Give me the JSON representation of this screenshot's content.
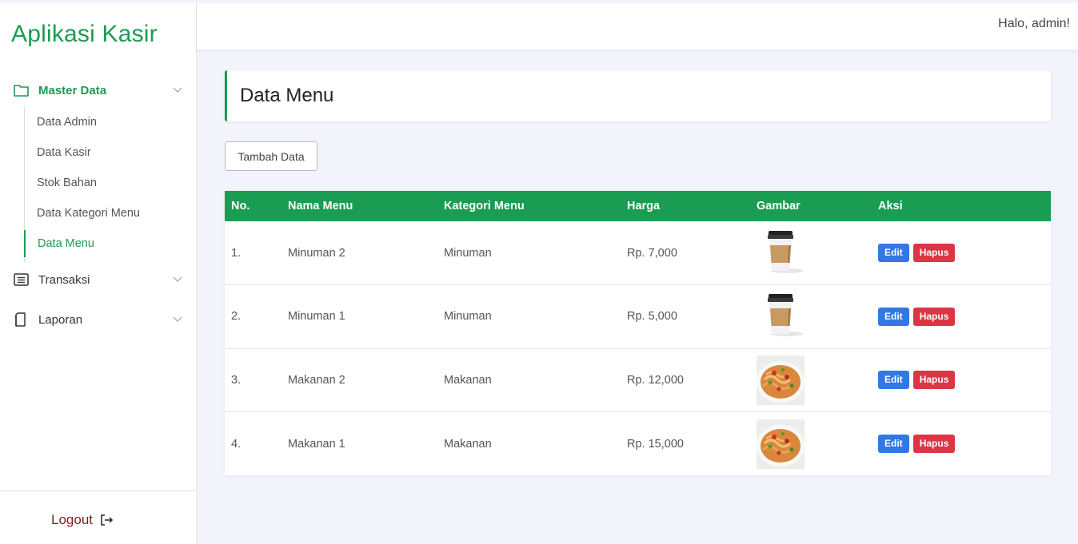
{
  "sidebar": {
    "brand": "Aplikasi Kasir",
    "groups": [
      {
        "label": "Master Data",
        "icon": "folder-icon",
        "expanded": true
      },
      {
        "label": "Transaksi",
        "icon": "list-icon",
        "expanded": false
      },
      {
        "label": "Laporan",
        "icon": "document-icon",
        "expanded": false
      }
    ],
    "master_items": [
      "Data Admin",
      "Data Kasir",
      "Stok Bahan",
      "Data Kategori Menu",
      "Data Menu"
    ],
    "active_item": "Data Menu",
    "logout_label": "Logout"
  },
  "topbar": {
    "greeting": "Halo, admin!"
  },
  "main": {
    "title": "Data Menu",
    "add_button": "Tambah Data",
    "table": {
      "headers": [
        "No.",
        "Nama Menu",
        "Kategori Menu",
        "Harga",
        "Gambar",
        "Aksi"
      ],
      "rows": [
        {
          "no": "1.",
          "name": "Minuman 2",
          "category": "Minuman",
          "price": "Rp. 7,000",
          "image": "coffee-cup"
        },
        {
          "no": "2.",
          "name": "Minuman 1",
          "category": "Minuman",
          "price": "Rp. 5,000",
          "image": "coffee-cup"
        },
        {
          "no": "3.",
          "name": "Makanan 2",
          "category": "Makanan",
          "price": "Rp. 12,000",
          "image": "noodle-dish"
        },
        {
          "no": "4.",
          "name": "Makanan 1",
          "category": "Makanan",
          "price": "Rp. 15,000",
          "image": "noodle-dish"
        }
      ],
      "edit_label": "Edit",
      "delete_label": "Hapus"
    }
  },
  "colors": {
    "primary": "#1a9c52",
    "edit": "#3178e4",
    "delete": "#dc3545",
    "background": "#f3f4fb"
  }
}
